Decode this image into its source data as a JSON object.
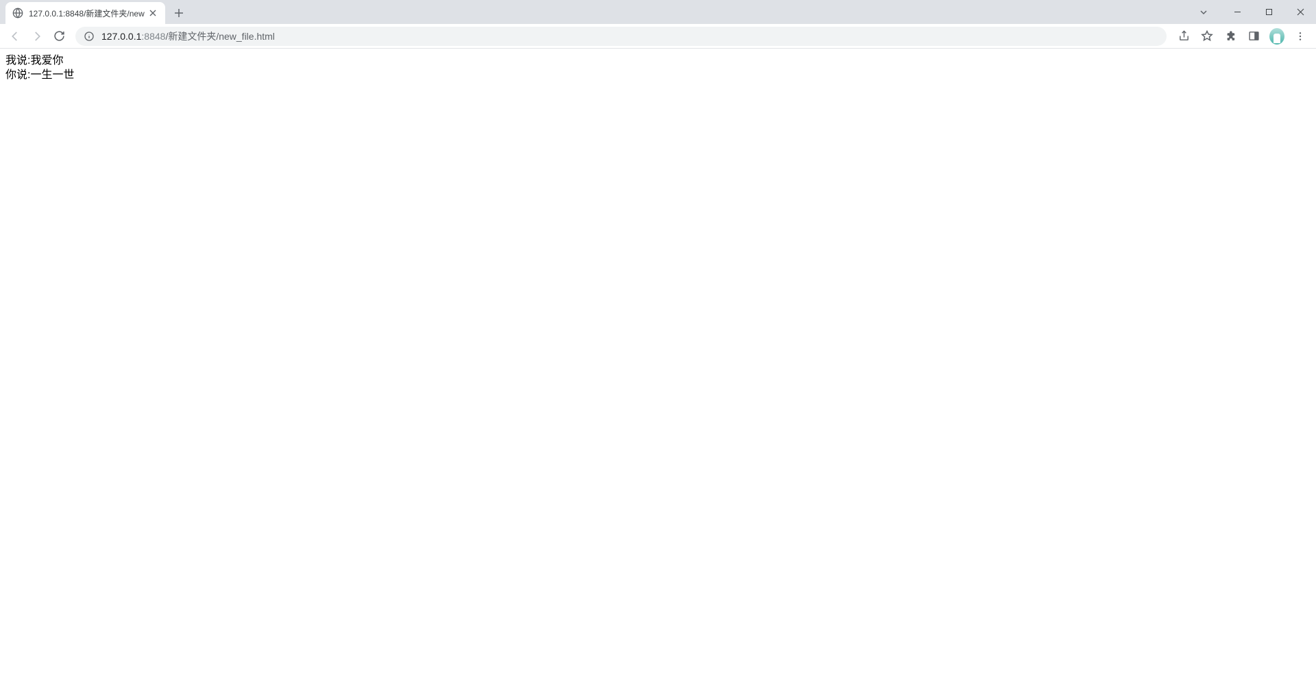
{
  "tab": {
    "title": "127.0.0.1:8848/新建文件夹/new"
  },
  "address": {
    "host": "127.0.0.1",
    "port": ":8848",
    "path": "/新建文件夹/new_file.html"
  },
  "page": {
    "line1": "我说:我爱你",
    "line2": "你说:一生一世"
  }
}
